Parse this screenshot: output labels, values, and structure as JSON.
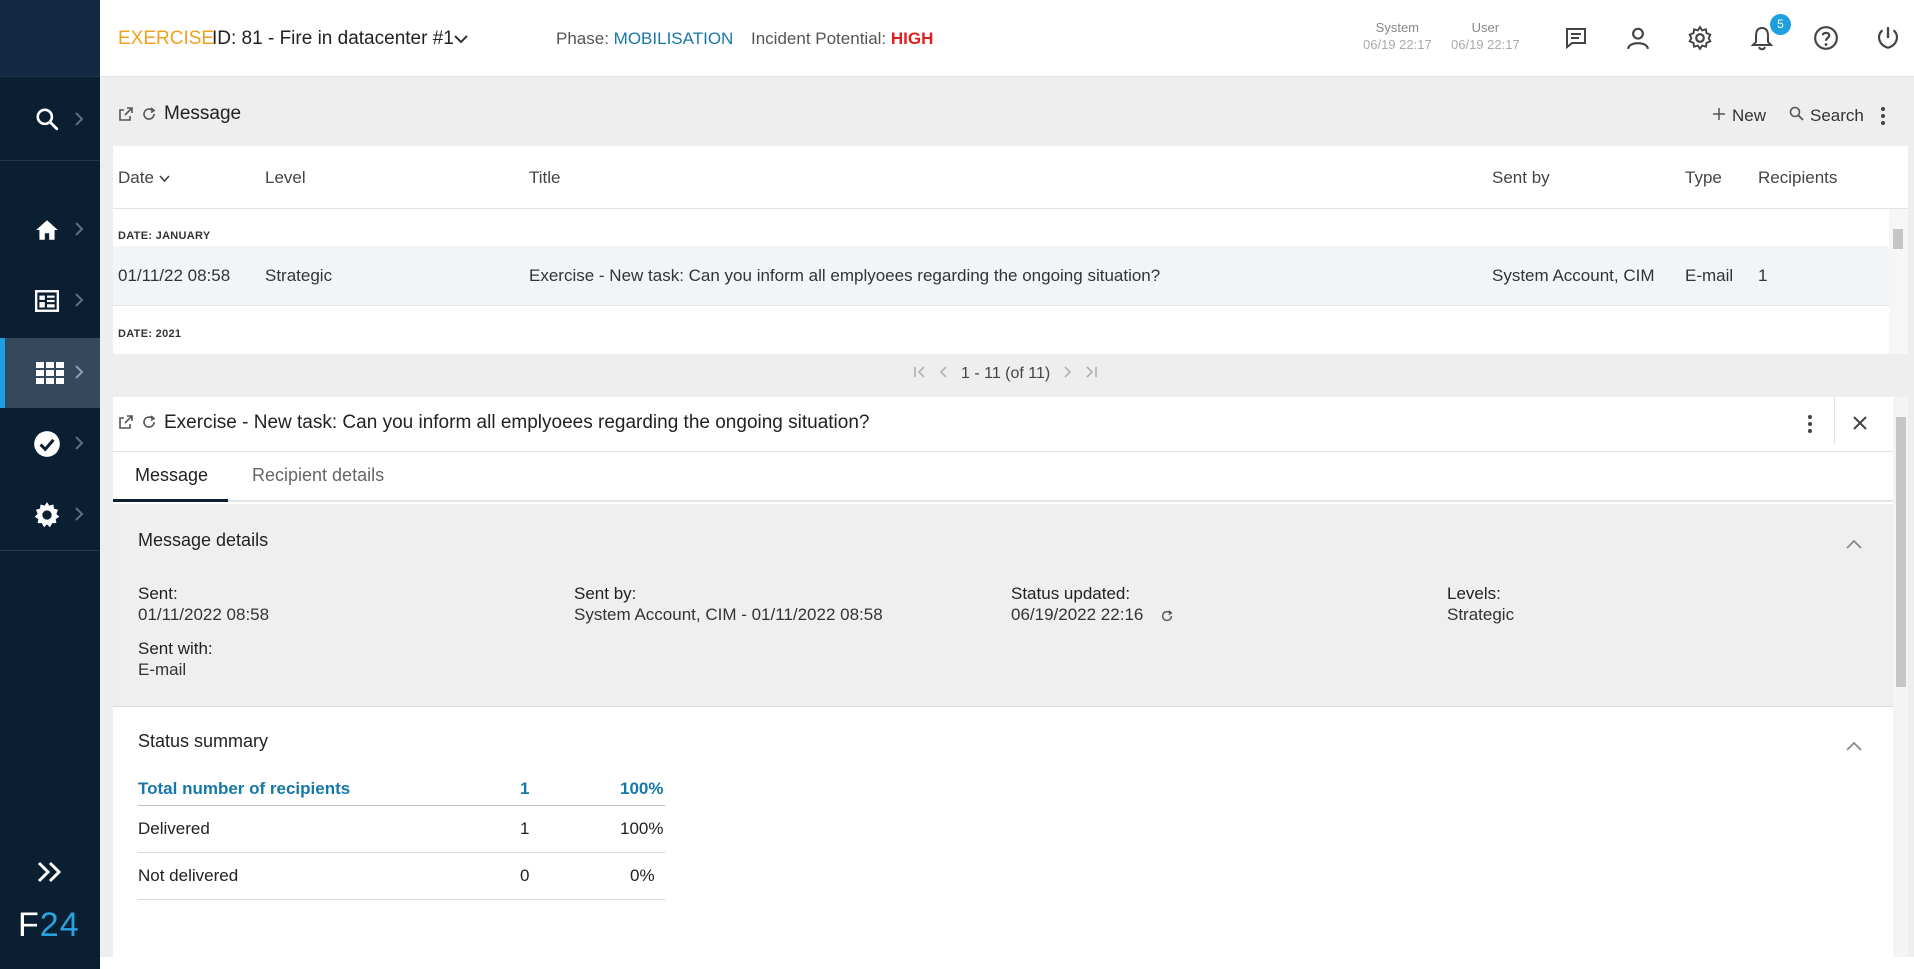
{
  "sidebar": {
    "brand_f": "F",
    "brand_num": "24",
    "items": [
      {
        "name": "search",
        "icon": "search-icon"
      },
      {
        "name": "home",
        "icon": "home-icon"
      },
      {
        "name": "dashboard",
        "icon": "dashboard-icon"
      },
      {
        "name": "apps",
        "icon": "apps-grid-icon",
        "active": true
      },
      {
        "name": "tasks",
        "icon": "check-circle-icon"
      },
      {
        "name": "settings",
        "icon": "gear-icon"
      }
    ]
  },
  "topbar": {
    "exercise_label": "EXERCISE",
    "exercise_id": "ID: 81 - Fire in datacenter #1",
    "phase_label": "Phase:",
    "phase_value": "MOBILISATION",
    "potential_label": "Incident Potential:",
    "potential_value": "HIGH",
    "system_label": "System",
    "system_time": "06/19 22:17",
    "user_label": "User",
    "user_time": "06/19 22:17",
    "notification_count": "5",
    "accent_color": "#f0a020",
    "high_color": "#e01e1e"
  },
  "messages": {
    "title": "Message",
    "new_label": "New",
    "search_label": "Search",
    "columns": [
      "Date",
      "Level",
      "Title",
      "Sent by",
      "Type",
      "Recipients"
    ],
    "groups": [
      "DATE: JANUARY",
      "DATE: 2021"
    ],
    "rows": [
      {
        "date": "01/11/22 08:58",
        "level": "Strategic",
        "title": "Exercise - New task: Can you inform all emplyoees regarding the ongoing situation?",
        "sent_by": "System Account, CIM",
        "type": "E-mail",
        "recipients": "1"
      }
    ],
    "pager": "1 - 11 (of 11)"
  },
  "detail": {
    "title": "Exercise - New task: Can you inform all emplyoees regarding the ongoing situation?",
    "tabs": [
      "Message",
      "Recipient details"
    ],
    "message_details": {
      "title": "Message details",
      "sent_label": "Sent:",
      "sent_value": "01/11/2022 08:58",
      "sent_by_label": "Sent by:",
      "sent_by_value": "System Account, CIM - 01/11/2022 08:58",
      "status_updated_label": "Status updated:",
      "status_updated_value": "06/19/2022 22:16",
      "levels_label": "Levels:",
      "levels_value": "Strategic",
      "sent_with_label": "Sent with:",
      "sent_with_value": "E-mail"
    },
    "status_summary": {
      "title": "Status summary",
      "rows": [
        {
          "label": "Total number of recipients",
          "count": "1",
          "percent": "100%"
        },
        {
          "label": "Delivered",
          "count": "1",
          "percent": "100%"
        },
        {
          "label": "Not delivered",
          "count": "0",
          "percent": "0%"
        }
      ]
    }
  }
}
